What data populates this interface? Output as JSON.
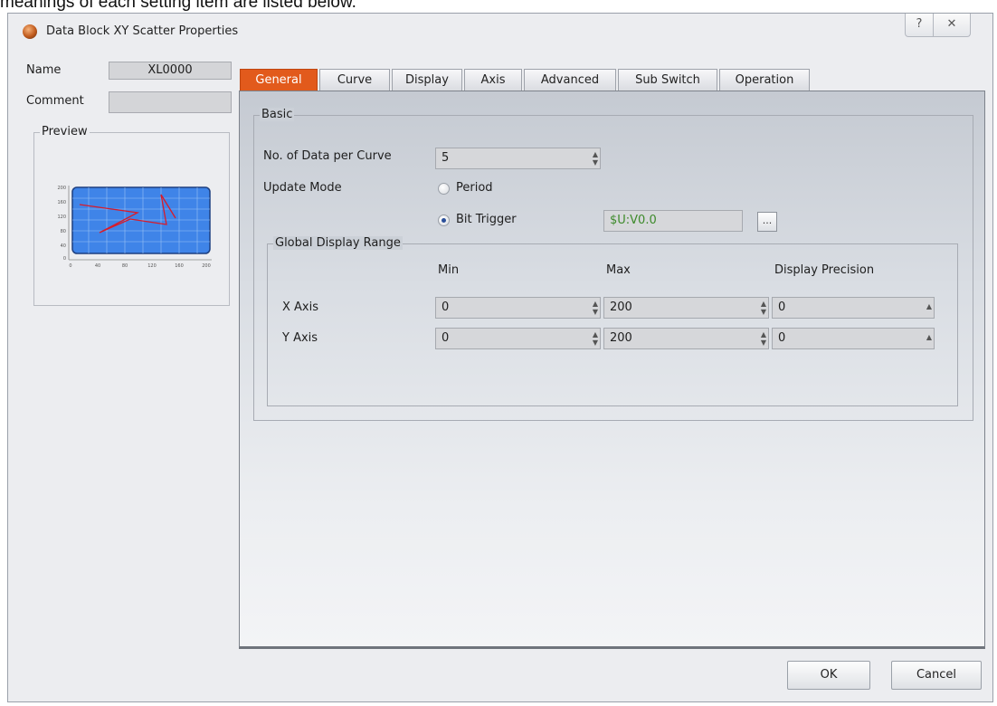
{
  "document": {
    "caption": "meanings of each setting item are listed below."
  },
  "window": {
    "title": "Data Block XY Scatter Properties",
    "help_glyph": "?",
    "close_glyph": "✕"
  },
  "object": {
    "name_label": "Name",
    "name_value": "XL0000",
    "comment_label": "Comment",
    "comment_value": ""
  },
  "preview": {
    "label": "Preview",
    "y_ticks": [
      "200",
      "160",
      "120",
      "80",
      "40",
      "0"
    ],
    "x_ticks": [
      "0",
      "40",
      "80",
      "120",
      "160",
      "200"
    ],
    "plot_color": "#3f84e8",
    "curve_color": "#d81b2a"
  },
  "tabs": [
    {
      "label": "General",
      "active": true
    },
    {
      "label": "Curve",
      "active": false
    },
    {
      "label": "Display",
      "active": false
    },
    {
      "label": "Axis",
      "active": false
    },
    {
      "label": "Advanced",
      "active": false
    },
    {
      "label": "Sub Switch",
      "active": false
    },
    {
      "label": "Operation",
      "active": false
    }
  ],
  "basic": {
    "group_label": "Basic",
    "data_per_curve_label": "No. of Data per Curve",
    "data_per_curve_value": "5",
    "update_mode_label": "Update Mode",
    "update_mode_options": [
      {
        "label": "Period",
        "selected": false
      },
      {
        "label": "Bit Trigger",
        "selected": true
      }
    ],
    "trigger_address": "$U:V0.0",
    "browse_label": "..."
  },
  "range": {
    "group_label": "Global Display Range",
    "col_min": "Min",
    "col_max": "Max",
    "col_precision": "Display Precision",
    "x_label": "X Axis",
    "x_min": "0",
    "x_max": "200",
    "x_precision": "0",
    "y_label": "Y Axis",
    "y_min": "0",
    "y_max": "200",
    "y_precision": "0"
  },
  "buttons": {
    "ok": "OK",
    "cancel": "Cancel"
  },
  "colors": {
    "active_tab": "#e25a1c",
    "address_text": "#3d8a2a"
  }
}
